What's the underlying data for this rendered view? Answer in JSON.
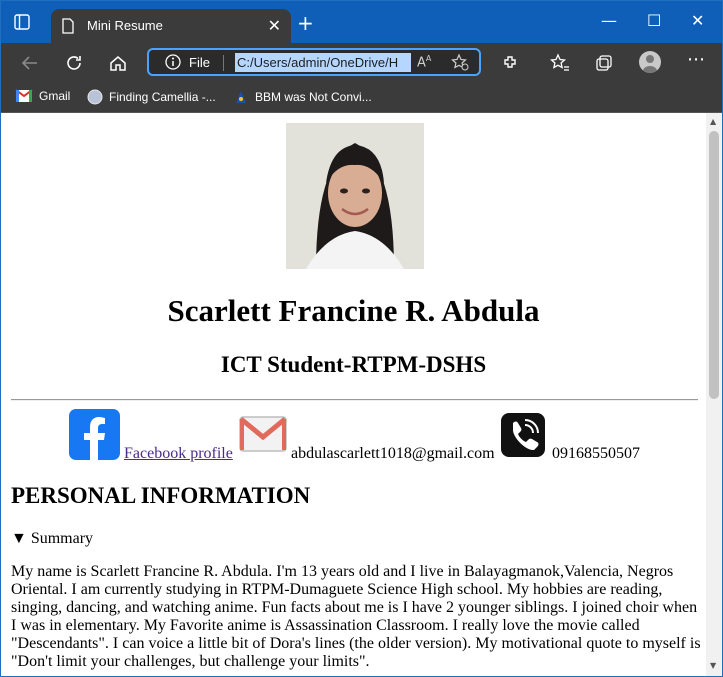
{
  "browser": {
    "tab_title": "Mini Resume",
    "tab_close": "✕",
    "new_tab": "+",
    "address_scheme": "File",
    "address_url": "C:/Users/admin/OneDrive/H",
    "read_aloud": "Aͅ",
    "bookmarks": [
      {
        "label": "Gmail",
        "icon": "gmail-icon"
      },
      {
        "label": "Finding Camellia -...",
        "icon": "globe-icon"
      },
      {
        "label": "BBM was Not Convi...",
        "icon": "bbm-icon"
      }
    ],
    "window_controls": {
      "minimize": "—",
      "maximize": "☐",
      "close": "✕"
    }
  },
  "resume": {
    "name": "Scarlett Francine R. Abdula",
    "role": "ICT Student-RTPM-DSHS",
    "facebook_label": "Facebook profile",
    "email": "abdulascarlett1018@gmail.com",
    "phone": "09168550507",
    "section_title": "PERSONAL INFORMATION",
    "summary_label": "▼ Summary",
    "summary_text": "My name is Scarlett Francine R. Abdula. I'm 13 years old and I live in Balayagmanok,Valencia, Negros Oriental. I am currently studying in RTPM-Dumaguete Science High school. My hobbies are reading, singing, dancing, and watching anime. Fun facts about me is I have 2 younger siblings. I joined choir when I was in elementary. My Favorite anime is Assassination Classroom. I really love the movie called \"Descendants\". I can voice a little bit of Dora's lines (the older version). My motivational quote to myself is \"Don't limit your challenges, but challenge your limits\"."
  },
  "colors": {
    "titlebar": "#0f5fb8",
    "toolbar": "#3b3b3b",
    "facebook": "#1877f2",
    "link": "#4b2a8a"
  }
}
